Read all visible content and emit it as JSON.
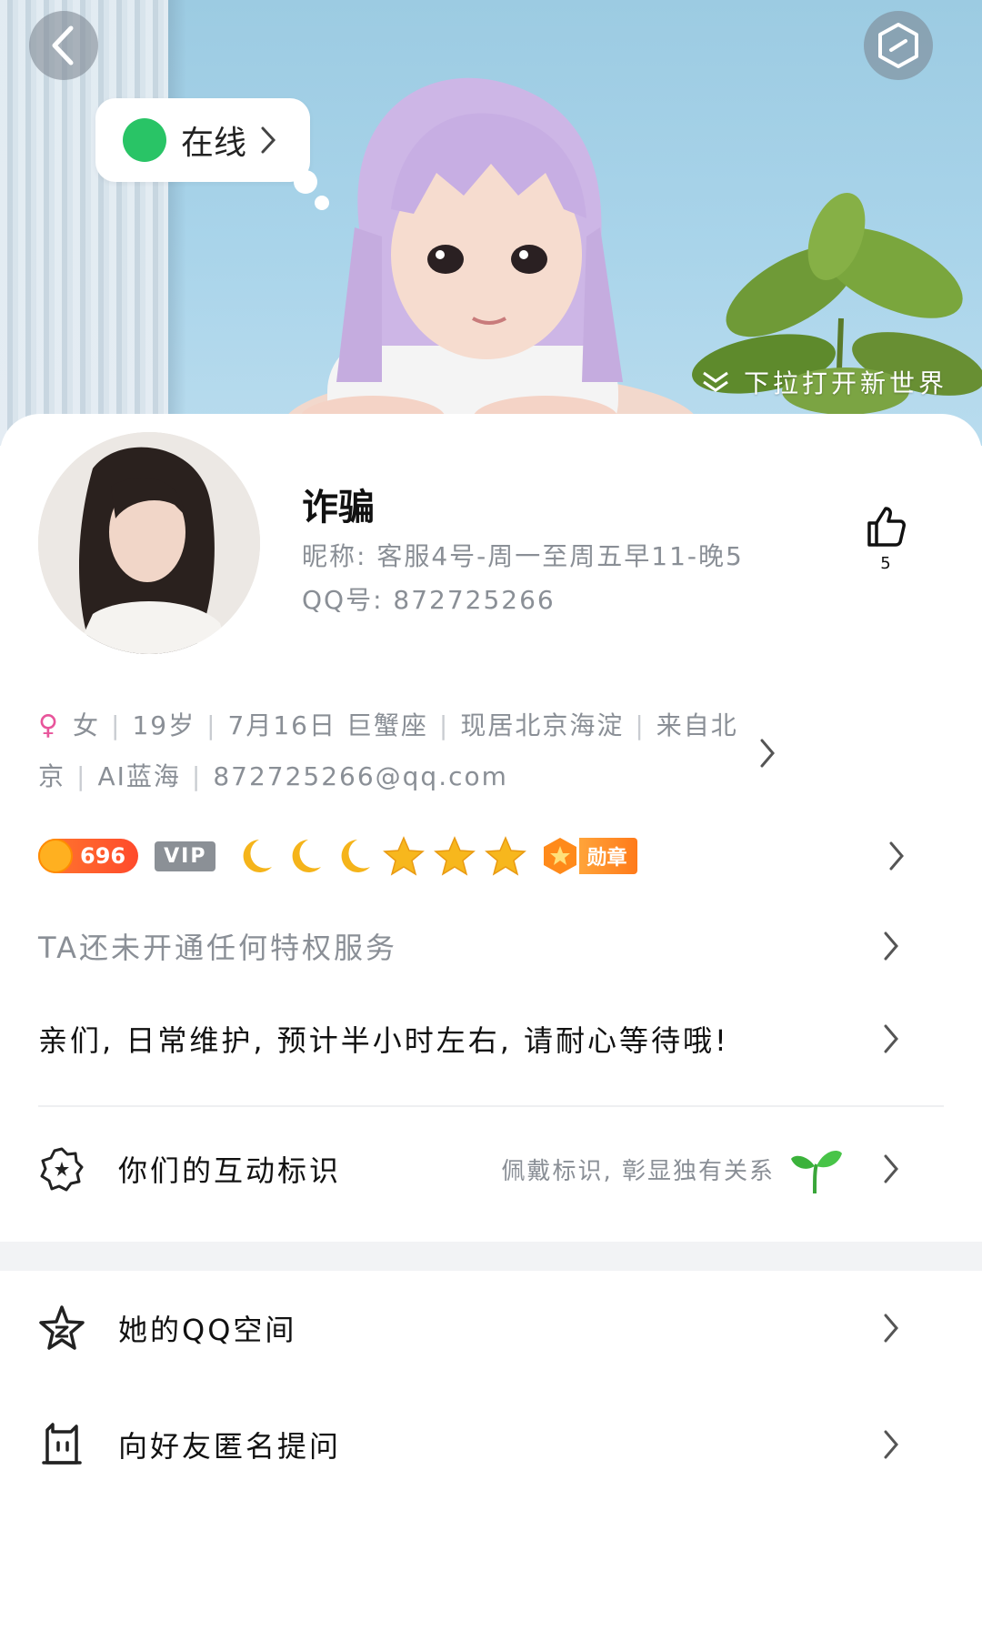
{
  "status": {
    "label": "在线"
  },
  "hero": {
    "pull_hint": "下拉打开新世界"
  },
  "profile": {
    "name": "诈骗",
    "nickname": "昵称: 客服4号-周一至周五早11-晚5",
    "qq": "QQ号: 872725266",
    "likes": "5"
  },
  "info": {
    "gender": "女",
    "age": "19岁",
    "birthday": "7月16日 巨蟹座",
    "location": "现居北京海淀",
    "hometown": "来自北京",
    "job": "AI蓝海",
    "email": "872725266@qq.com"
  },
  "badges": {
    "coin": "696",
    "vip": "VIP",
    "medal": "勋章"
  },
  "rows": {
    "privilege": "TA还未开通任何特权服务",
    "signature": "亲们, 日常维护, 预计半小时左右, 请耐心等待哦!",
    "interaction": "你们的互动标识",
    "interaction_hint": "佩戴标识, 彰显独有关系",
    "qzone": "她的QQ空间",
    "anonymous": "向好友匿名提问"
  }
}
